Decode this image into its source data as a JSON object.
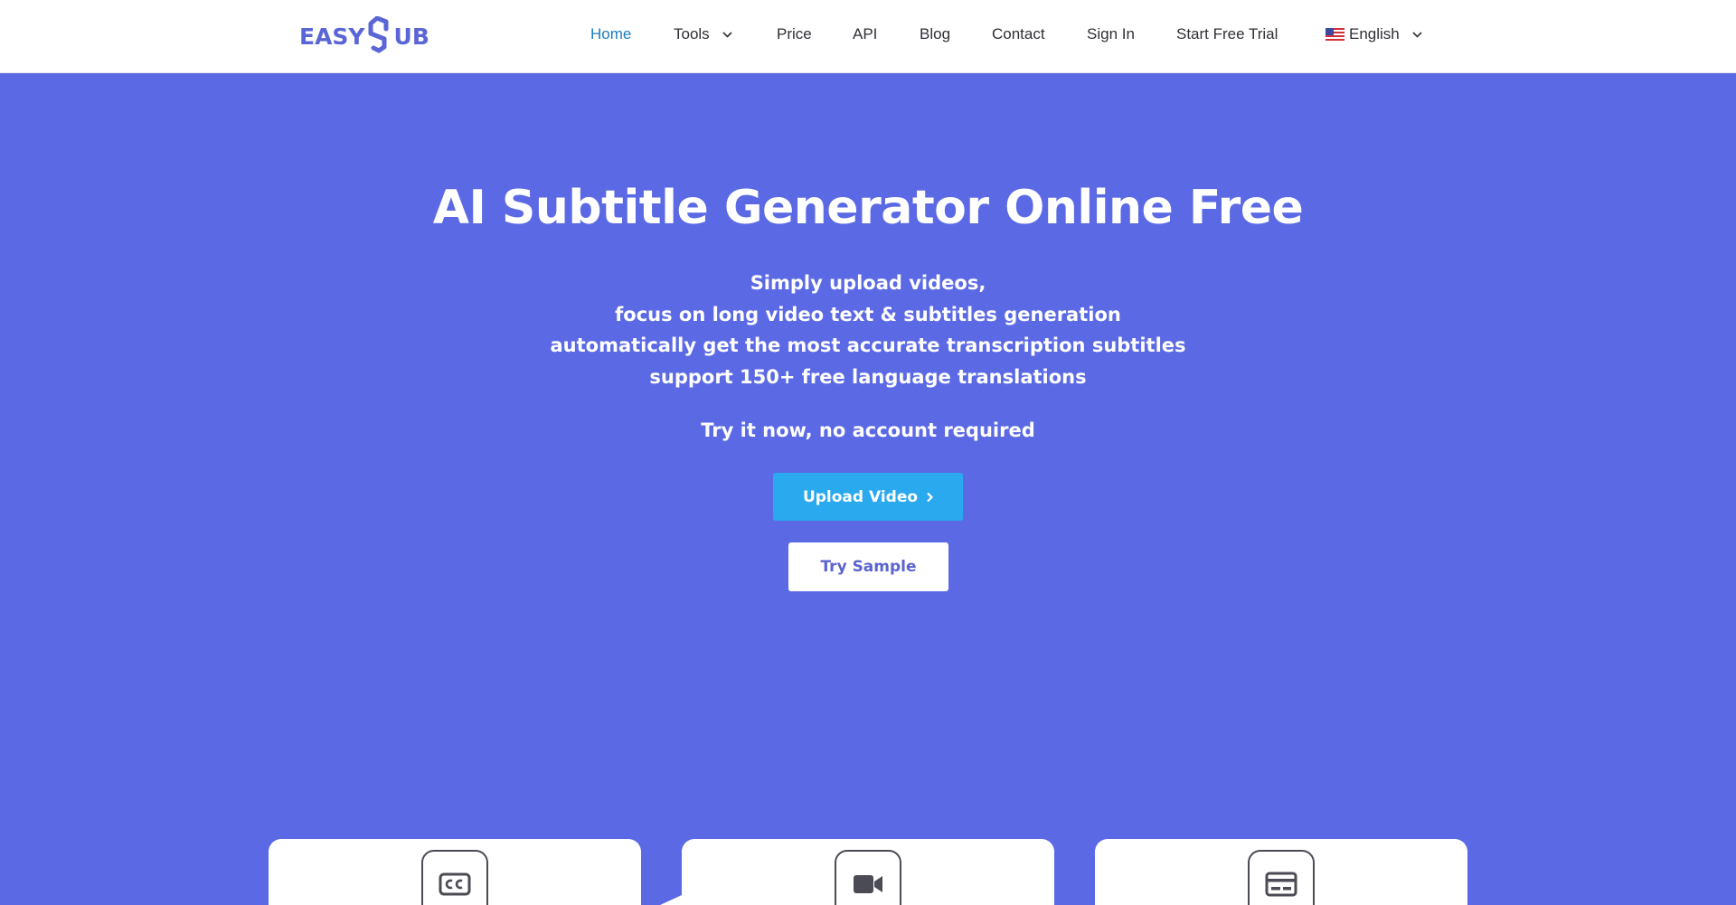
{
  "header": {
    "logo": {
      "prefix": "EASY",
      "suffix": "UB",
      "brand_color": "#5b66d6"
    },
    "nav": {
      "home": "Home",
      "tools": "Tools",
      "price": "Price",
      "api": "API",
      "blog": "Blog",
      "contact": "Contact",
      "sign_in": "Sign In",
      "start_free_trial": "Start Free Trial",
      "language": "English"
    },
    "active_color": "#1d7bbf"
  },
  "hero": {
    "title": "AI Subtitle Generator Online Free",
    "lines": [
      "Simply upload videos,",
      "focus on long video text & subtitles generation",
      "automatically get the most accurate transcription subtitles",
      "support 150+ free language translations"
    ],
    "cta_note": "Try it now, no account required",
    "upload_button": "Upload Video",
    "sample_button": "Try Sample",
    "background_color": "#5b6ae4",
    "upload_color": "#2ba9ef"
  },
  "features": [
    {
      "icon": "closed-captions-icon"
    },
    {
      "icon": "video-camera-icon"
    },
    {
      "icon": "subtitles-card-icon"
    }
  ]
}
